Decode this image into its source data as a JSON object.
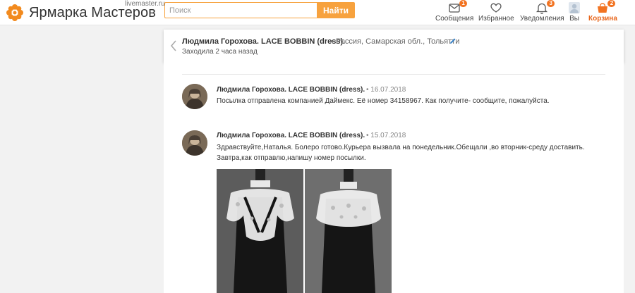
{
  "header": {
    "logo_text": "Ярмарка Мастеров",
    "logo_domain": "livemaster.ru",
    "search_placeholder": "Поиск",
    "search_button": "Найти",
    "nav": {
      "messages": {
        "label": "Сообщения",
        "badge": "1"
      },
      "favorites": {
        "label": "Избранное"
      },
      "notifications": {
        "label": "Уведомления",
        "badge": "3"
      },
      "profile": {
        "label": "Вы"
      },
      "cart": {
        "label": "Корзина",
        "badge": "2"
      }
    }
  },
  "contact": {
    "name": "Людмила Горохова. LACE BOBBIN (dress).",
    "location": "• Россия, Самарская обл., Тольятти",
    "status": "Заходила 2 часа назад"
  },
  "messages": [
    {
      "author": "Людмила Горохова. LACE BOBBIN (dress).",
      "date": "•  16.07.2018",
      "text": "Посылка отправлена компанией Даймекс. Её номер 34158967. Как получите- сообщите, пожалуйста."
    },
    {
      "author": "Людмила Горохова. LACE BOBBIN (dress).",
      "date": "•  15.07.2018",
      "text": "Здравствуйте,Наталья. Болеро готово.Курьера вызвала на понедельник.Обещали ,во вторник-среду доставить. Завтра,как отправлю,напишу номер посылки."
    }
  ],
  "colors": {
    "accent": "#f7a23e",
    "badge": "#f27321",
    "cart": "#e8651a"
  }
}
